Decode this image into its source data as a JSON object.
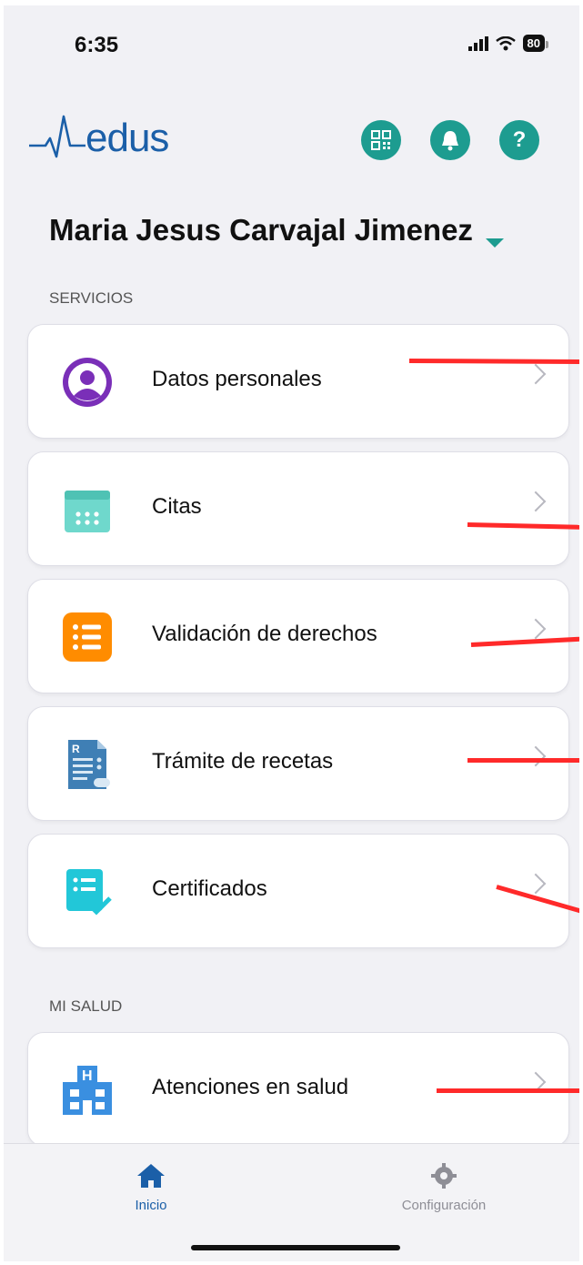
{
  "status_bar": {
    "time": "6:35",
    "battery": "80"
  },
  "header": {
    "logo_text": "edus",
    "actions": [
      {
        "name": "qr-code-button",
        "icon": "qr-code-icon"
      },
      {
        "name": "notifications-button",
        "icon": "bell-icon"
      },
      {
        "name": "help-button",
        "icon": "question-icon",
        "glyph": "?"
      }
    ],
    "accent_color": "#1d9c90"
  },
  "user": {
    "name": "Maria Jesus Carvajal Jimenez"
  },
  "sections": {
    "servicios": {
      "label": "SERVICIOS",
      "items": [
        {
          "label": "Datos personales",
          "icon": "user-circle-icon"
        },
        {
          "label": "Citas",
          "icon": "calendar-icon"
        },
        {
          "label": "Validación de derechos",
          "icon": "list-icon"
        },
        {
          "label": "Trámite de recetas",
          "icon": "prescription-icon"
        },
        {
          "label": "Certificados",
          "icon": "certificate-icon"
        }
      ]
    },
    "mi_salud": {
      "label": "MI SALUD",
      "items": [
        {
          "label": "Atenciones en salud",
          "icon": "hospital-icon"
        }
      ]
    }
  },
  "tabbar": {
    "tabs": [
      {
        "label": "Inicio",
        "icon": "home-icon",
        "active": true
      },
      {
        "label": "Configuración",
        "icon": "gear-icon",
        "active": false
      }
    ]
  }
}
